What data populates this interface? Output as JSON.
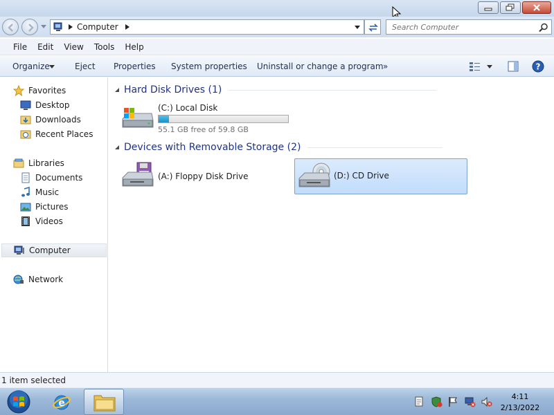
{
  "window": {
    "minimize_icon": "minimize-icon",
    "maximize_icon": "restore-icon",
    "close_icon": "close-icon"
  },
  "address": {
    "crumb": "Computer",
    "search_placeholder": "Search Computer"
  },
  "menu": {
    "file": "File",
    "edit": "Edit",
    "view": "View",
    "tools": "Tools",
    "help": "Help"
  },
  "commands": {
    "organize": "Organize",
    "eject": "Eject",
    "properties": "Properties",
    "system_properties": "System properties",
    "uninstall": "Uninstall or change a program",
    "more": "»"
  },
  "nav": {
    "favorites": "Favorites",
    "desktop": "Desktop",
    "downloads": "Downloads",
    "recent_places": "Recent Places",
    "libraries": "Libraries",
    "documents": "Documents",
    "music": "Music",
    "pictures": "Pictures",
    "videos": "Videos",
    "computer": "Computer",
    "network": "Network"
  },
  "groups": {
    "hard_disks": "Hard Disk Drives (1)",
    "removable": "Devices with Removable Storage (2)"
  },
  "drives": {
    "c_name": "(C:) Local Disk",
    "c_free": "55.1 GB free of 59.8 GB",
    "c_used_fraction": 0.079,
    "a_name": "(A:) Floppy Disk Drive",
    "d_name": "(D:) CD Drive"
  },
  "status": {
    "selection": "1 item selected"
  },
  "clock": {
    "time": "4:11",
    "date": "2/13/2022"
  },
  "colors": {
    "accent": "#1e3287",
    "selection": "#c1dcfc",
    "bar_fill": "#1f8fc5"
  }
}
